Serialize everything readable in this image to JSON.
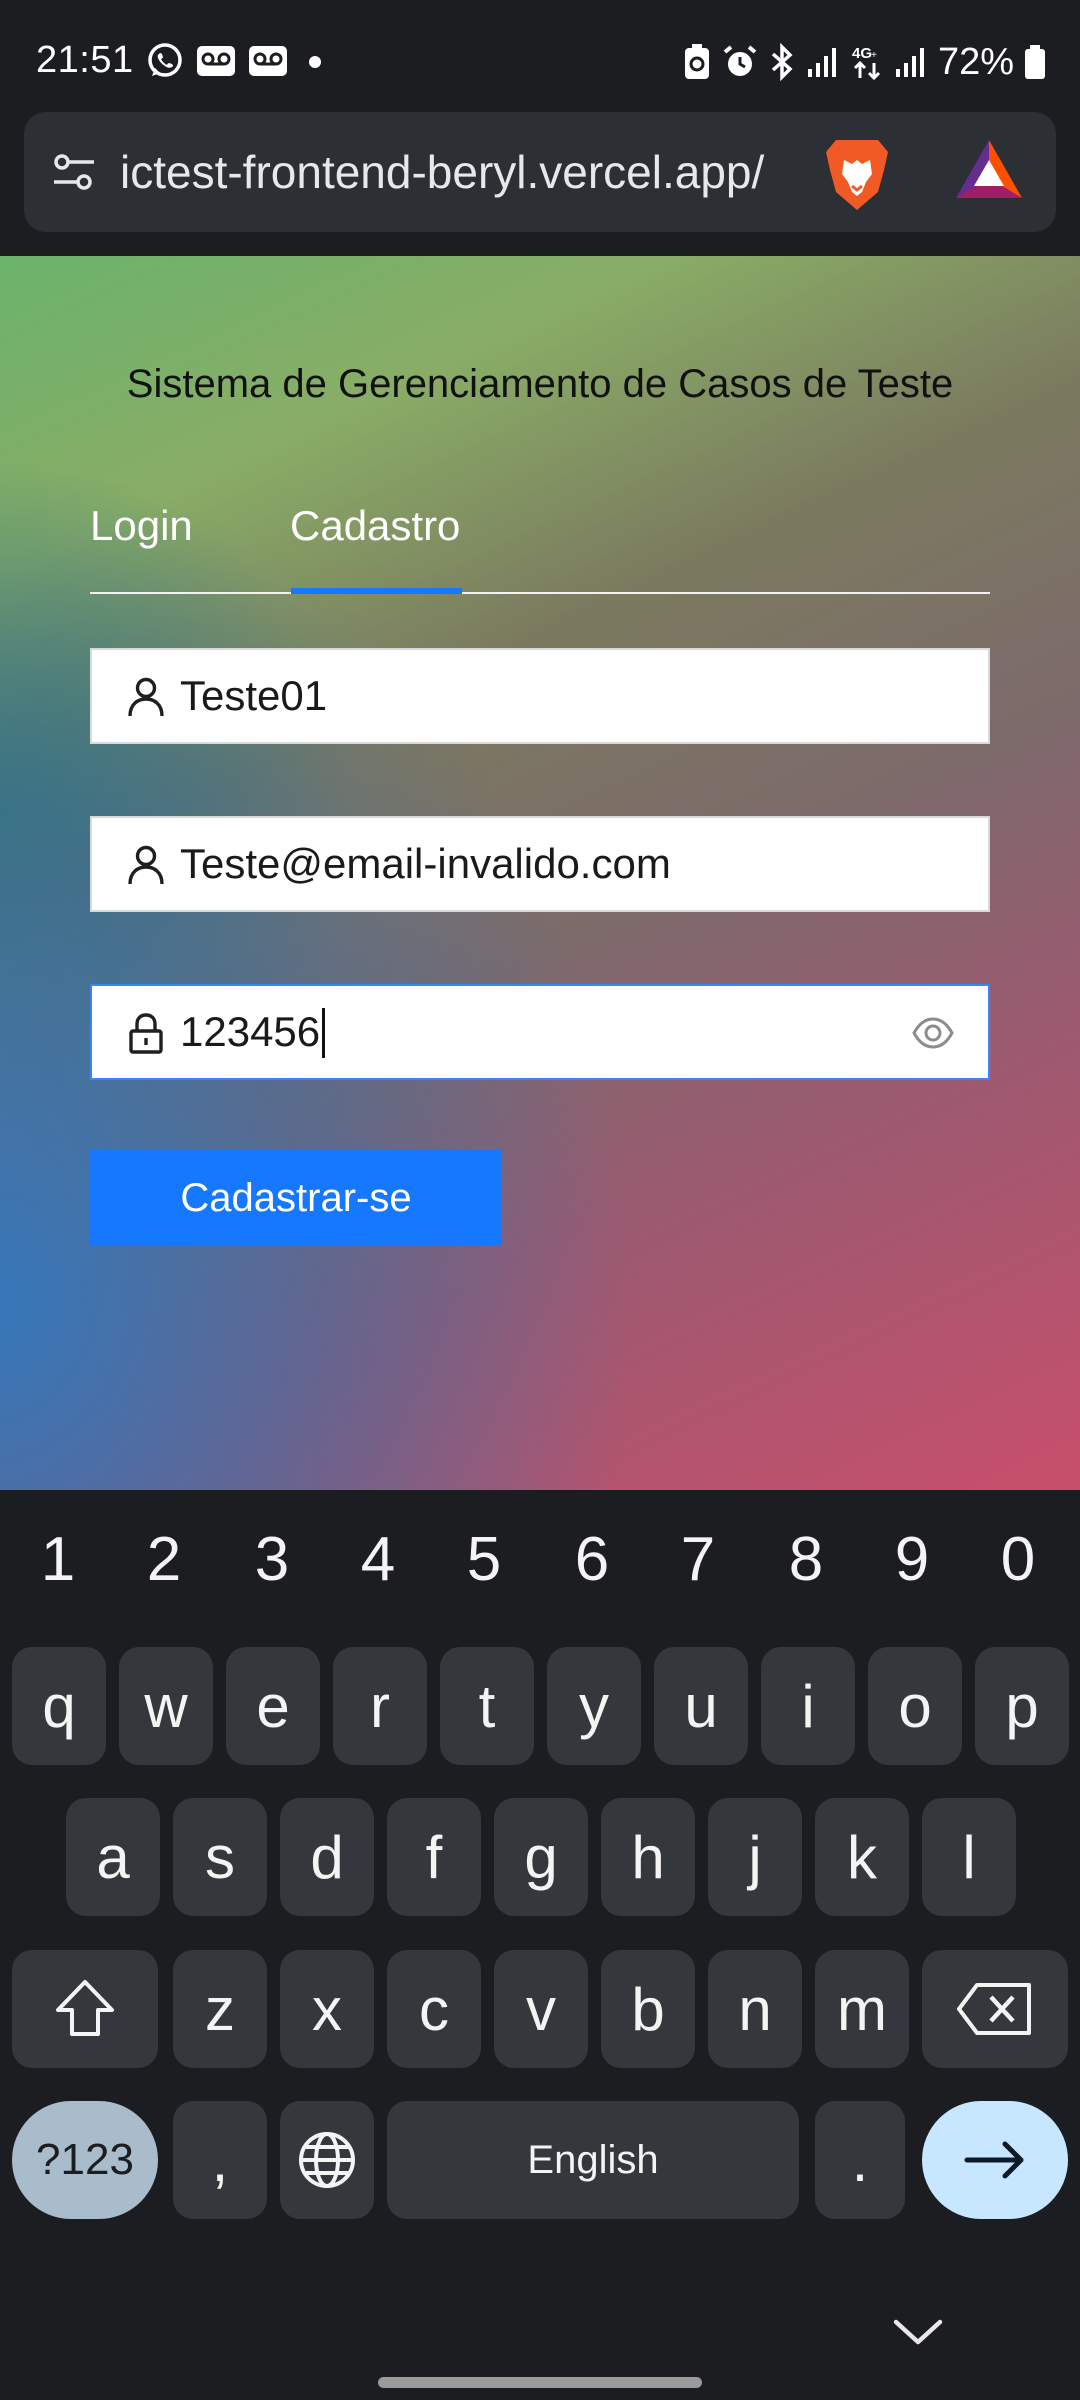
{
  "status_bar": {
    "time": "21:51",
    "battery_percent": "72%",
    "left_icons": [
      "whatsapp-icon",
      "voicemail-icon",
      "voicemail-icon",
      "dot-icon"
    ],
    "right_icons": [
      "battery-saver-icon",
      "alarm-icon",
      "bluetooth-icon",
      "signal-icon",
      "4g-icon",
      "signal-icon",
      "battery-icon"
    ]
  },
  "browser": {
    "url": "ictest-frontend-beryl.vercel.app/",
    "icons": [
      "tune-icon",
      "brave-lion-icon",
      "bat-rewards-icon"
    ]
  },
  "page": {
    "title": "Sistema de Gerenciamento de Casos de Teste",
    "tabs": [
      {
        "label": "Login",
        "active": false
      },
      {
        "label": "Cadastro",
        "active": true
      }
    ],
    "fields": {
      "username": {
        "value": "Teste01",
        "icon": "user-icon"
      },
      "email": {
        "value": "Teste@email-invalido.com",
        "icon": "user-icon"
      },
      "password": {
        "value": "123456",
        "icon": "lock-icon",
        "trailing_icon": "eye-icon"
      }
    },
    "submit_label": "Cadastrar-se",
    "accent_color": "#1677ff"
  },
  "keyboard": {
    "number_row": [
      "1",
      "2",
      "3",
      "4",
      "5",
      "6",
      "7",
      "8",
      "9",
      "0"
    ],
    "row1": [
      "q",
      "w",
      "e",
      "r",
      "t",
      "y",
      "u",
      "i",
      "o",
      "p"
    ],
    "row2": [
      "a",
      "s",
      "d",
      "f",
      "g",
      "h",
      "j",
      "k",
      "l"
    ],
    "row3": [
      "z",
      "x",
      "c",
      "v",
      "b",
      "n",
      "m"
    ],
    "symbols_label": "?123",
    "comma_label": ",",
    "space_label": "English",
    "period_label": "."
  }
}
